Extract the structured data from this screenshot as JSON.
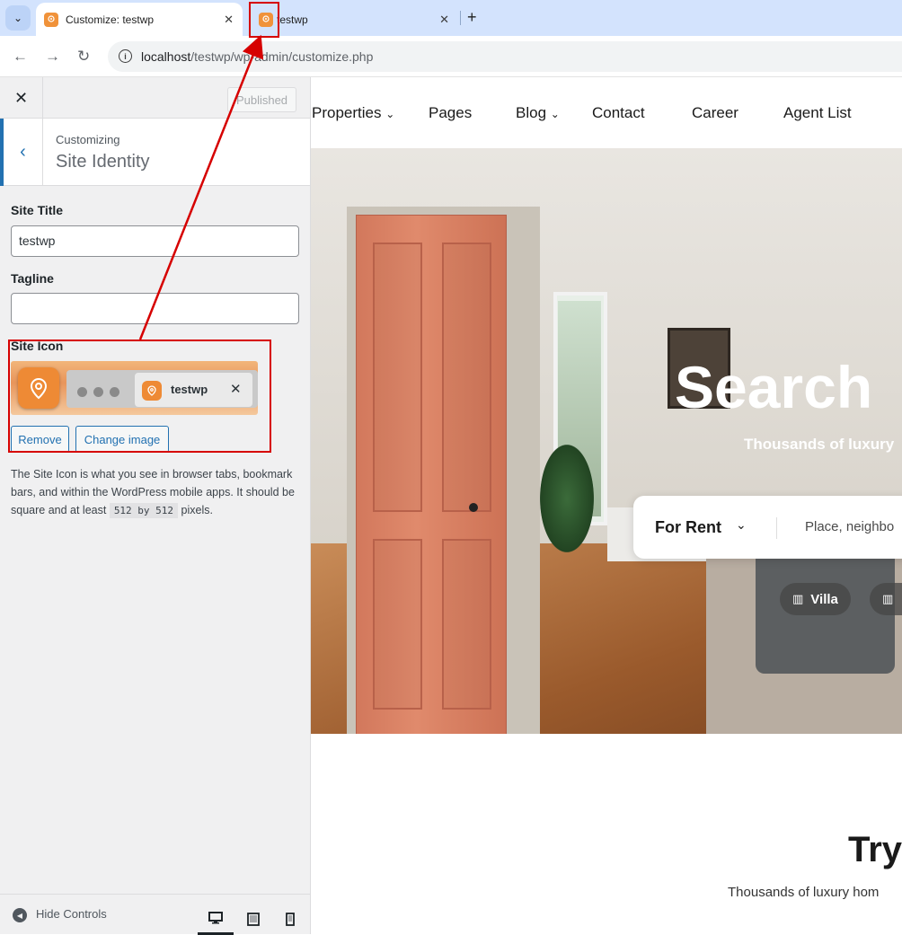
{
  "browser": {
    "tabs": [
      {
        "title": "Customize: testwp",
        "active": true
      },
      {
        "title": "testwp",
        "active": false
      }
    ],
    "url_host": "localhost",
    "url_path": "/testwp/wp-admin/customize.php"
  },
  "customizer": {
    "publish_label": "Published",
    "section_context": "Customizing",
    "section_title": "Site Identity",
    "site_title_label": "Site Title",
    "site_title_value": "testwp",
    "tagline_label": "Tagline",
    "tagline_value": "",
    "site_icon_label": "Site Icon",
    "preview_tab_name": "testwp",
    "remove_label": "Remove",
    "change_image_label": "Change image",
    "description_part1": "The Site Icon is what you see in browser tabs, bookmark bars, and within the WordPress mobile apps. It should be square and at least",
    "description_code": "512 by 512",
    "description_part2": "pixels.",
    "hide_controls_label": "Hide Controls"
  },
  "site": {
    "menu": [
      "Properties",
      "Pages",
      "Blog",
      "Contact",
      "Career",
      "Agent List"
    ],
    "hero_title": "Search",
    "hero_subtitle": "Thousands of luxury",
    "search_type": "For Rent",
    "search_placeholder": "Place, neighbo",
    "chips": [
      "Villa"
    ],
    "section_title": "Try",
    "section_subtitle": "Thousands of luxury hom"
  },
  "colors": {
    "favicon": "#f0923a",
    "wp_blue": "#2271b1",
    "annotation_red": "#d60000"
  }
}
